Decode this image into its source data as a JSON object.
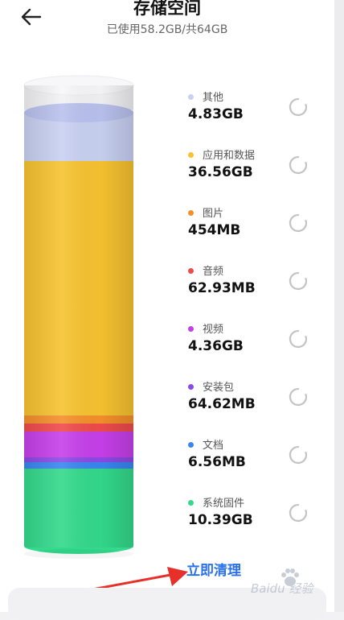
{
  "header": {
    "title": "存储空间",
    "subtitle": "已使用58.2GB/共64GB"
  },
  "categories": [
    {
      "name": "其他",
      "size": "4.83GB",
      "color": "#c9d1f2"
    },
    {
      "name": "应用和数据",
      "size": "36.56GB",
      "color": "#f7c330"
    },
    {
      "name": "图片",
      "size": "454MB",
      "color": "#f58f2c"
    },
    {
      "name": "音频",
      "size": "62.93MB",
      "color": "#ef4b4b"
    },
    {
      "name": "视频",
      "size": "4.36GB",
      "color": "#c640ea"
    },
    {
      "name": "安装包",
      "size": "64.62MB",
      "color": "#8c49e6"
    },
    {
      "name": "文档",
      "size": "6.56MB",
      "color": "#3a86f0"
    },
    {
      "name": "系统固件",
      "size": "10.39GB",
      "color": "#33d98c"
    }
  ],
  "action": {
    "clean_label": "立即清理"
  },
  "watermark": {
    "text": "Baidu 经验"
  },
  "colors": {
    "accent": "#2a72e8",
    "arrow": "#e8302b"
  },
  "icons": {
    "back": "arrow-left-icon",
    "loading": "loading-spinner-icon"
  }
}
